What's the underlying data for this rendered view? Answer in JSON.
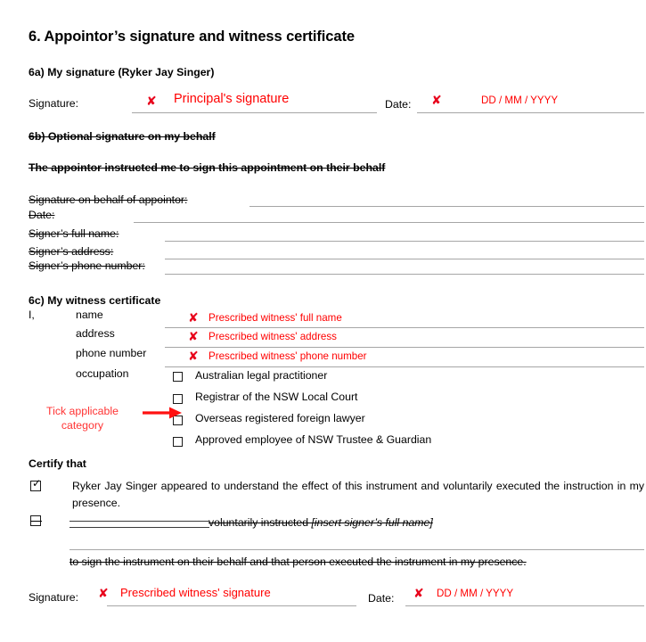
{
  "document": {
    "section_heading": "6. Appointor’s signature and witness certificate"
  },
  "section_6a": {
    "label": "6a)  My signature (Ryker Jay Singer)",
    "signature_label": "Signature:",
    "signature_xmark": "✘",
    "signature_value": "Principal's signature",
    "date_label": "Date:",
    "date_xmark": "✘",
    "date_value": "DD / MM  /  YYYY"
  },
  "section_6b": {
    "label": "6b)  Optional    signature on my behalf",
    "statement": "The appointor instructed me to sign this appointment on their behalf",
    "rows": [
      {
        "label": "Signature on behalf of appointor:",
        "value": ""
      },
      {
        "label": "Date:",
        "value": ""
      },
      {
        "label": "Signer’s full name:",
        "value": ""
      },
      {
        "label": "Signer’s address:",
        "value": ""
      },
      {
        "label": "Signer’s phone number:",
        "value": ""
      }
    ]
  },
  "section_6c": {
    "label": "6c)  My witness certificate",
    "i_label": "I,",
    "fields": [
      {
        "label": "name",
        "xmark": "✘",
        "value": "Prescribed witness' full name"
      },
      {
        "label": "address",
        "xmark": "✘",
        "value": "Prescribed witness' address"
      },
      {
        "label": "phone number",
        "xmark": "✘",
        "value": "Prescribed witness' phone number"
      }
    ],
    "occupation_label": "occupation",
    "occupation_options": [
      {
        "label": "Australian legal practitioner",
        "checked": false
      },
      {
        "label": "Registrar of the NSW Local Court",
        "checked": false
      },
      {
        "label": "Overseas registered foreign lawyer",
        "checked": false
      },
      {
        "label": "Approved employee of NSW Trustee & Guardian",
        "checked": false
      }
    ],
    "annotation": {
      "line1": "Tick applicable",
      "line2": "category",
      "color": "#ff3333"
    }
  },
  "certify": {
    "heading": "Certify that",
    "item1": {
      "checked": true,
      "text": "Ryker Jay Singer appeared to understand the effect of this instrument and voluntarily executed the instruction in my presence."
    },
    "item2": {
      "checked": false,
      "struck": true,
      "text_plain": "voluntarily instructed ",
      "text_italic": "[insert signer’s full name]",
      "continuation": "to sign the instrument on their behalf and that person executed the instrument in my presence."
    }
  },
  "witness_signature": {
    "signature_label": "Signature:",
    "signature_xmark": "✘",
    "signature_value": "Prescribed witness' signature",
    "date_label": "Date:",
    "date_xmark": "✘",
    "date_value": "DD / MM  /  YYYY"
  },
  "colors": {
    "red_mark": "#e8031b",
    "red_text": "#ff0000",
    "annotation_red": "#ff3333",
    "rule": "#a6a6a6"
  }
}
